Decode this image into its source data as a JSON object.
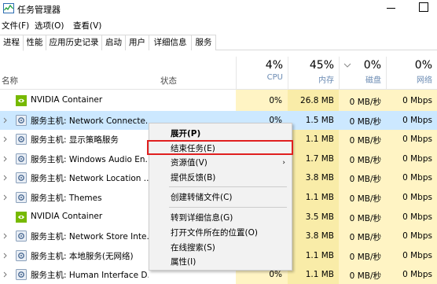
{
  "window": {
    "title": "任务管理器"
  },
  "menubar": {
    "items": [
      "文件(F)",
      "选项(O)",
      "查看(V)"
    ]
  },
  "tabs": [
    "进程",
    "性能",
    "应用历史记录",
    "启动",
    "用户",
    "详细信息",
    "服务"
  ],
  "active_tab": "进程",
  "columns": {
    "name": "名称",
    "status": "状态",
    "cpu": {
      "pct": "4%",
      "label": "CPU"
    },
    "memory": {
      "pct": "45%",
      "label": "内存"
    },
    "disk": {
      "pct": "0%",
      "label": "磁盘"
    },
    "network": {
      "pct": "0%",
      "label": "网络"
    }
  },
  "rows": [
    {
      "name": "NVIDIA Container",
      "icon": "nvidia-icon",
      "expandable": false,
      "cpu": "0%",
      "memory": "26.8 MB",
      "disk": "0 MB/秒",
      "network": "0 Mbps"
    },
    {
      "name": "服务主机: Network Connecte...",
      "icon": "gear-icon",
      "expandable": true,
      "cpu": "0%",
      "memory": "1.5 MB",
      "disk": "0 MB/秒",
      "network": "0 Mbps"
    },
    {
      "name": "服务主机: 显示策略服务",
      "icon": "gear-icon",
      "expandable": true,
      "cpu": "",
      "memory": "1.1 MB",
      "disk": "0 MB/秒",
      "network": "0 Mbps"
    },
    {
      "name": "服务主机: Windows Audio En...",
      "icon": "gear-icon",
      "expandable": true,
      "cpu": "",
      "memory": "1.7 MB",
      "disk": "0 MB/秒",
      "network": "0 Mbps"
    },
    {
      "name": "服务主机: Network Location ...",
      "icon": "gear-icon",
      "expandable": true,
      "cpu": "",
      "memory": "3.8 MB",
      "disk": "0 MB/秒",
      "network": "0 Mbps"
    },
    {
      "name": "服务主机: Themes",
      "icon": "gear-icon",
      "expandable": true,
      "cpu": "",
      "memory": "1.1 MB",
      "disk": "0 MB/秒",
      "network": "0 Mbps"
    },
    {
      "name": "NVIDIA Container",
      "icon": "nvidia-icon",
      "expandable": false,
      "cpu": "",
      "memory": "3.5 MB",
      "disk": "0 MB/秒",
      "network": "0 Mbps"
    },
    {
      "name": "服务主机: Network Store Inte...",
      "icon": "gear-icon",
      "expandable": true,
      "cpu": "",
      "memory": "3.8 MB",
      "disk": "0 MB/秒",
      "network": "0 Mbps"
    },
    {
      "name": "服务主机: 本地服务(无网络)",
      "icon": "gear-icon",
      "expandable": true,
      "cpu": "",
      "memory": "1.1 MB",
      "disk": "0 MB/秒",
      "network": "0 Mbps"
    },
    {
      "name": "服务主机: Human Interface D...",
      "icon": "gear-icon",
      "expandable": true,
      "cpu": "0%",
      "memory": "1.1 MB",
      "disk": "0 MB/秒",
      "network": "0 Mbps"
    }
  ],
  "context_menu": {
    "items": [
      {
        "label": "展开(P)",
        "bold": true,
        "submenu": false
      },
      {
        "label": "结束任务(E)",
        "bold": false,
        "submenu": false,
        "highlighted": true
      },
      {
        "label": "资源值(V)",
        "bold": false,
        "submenu": true
      },
      {
        "label": "提供反馈(B)",
        "bold": false,
        "submenu": false
      },
      {
        "label": "创建转储文件(C)",
        "bold": false,
        "submenu": false
      },
      {
        "label": "转到详细信息(G)",
        "bold": false,
        "submenu": false
      },
      {
        "label": "打开文件所在的位置(O)",
        "bold": false,
        "submenu": false
      },
      {
        "label": "在线搜索(S)",
        "bold": false,
        "submenu": false
      },
      {
        "label": "属性(I)",
        "bold": false,
        "submenu": false
      }
    ]
  },
  "colors": {
    "metric_bg": "#fff4c4",
    "selected_row": "#cce8ff",
    "highlight_box": "#e02020",
    "header_label": "#6b8bb3"
  }
}
